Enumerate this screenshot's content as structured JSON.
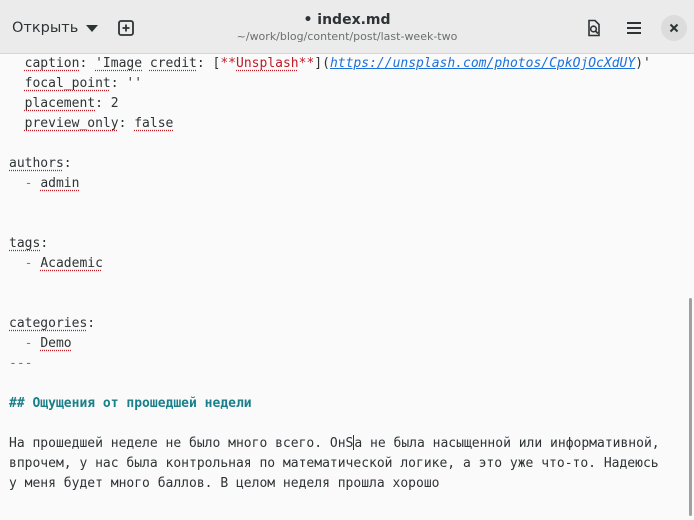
{
  "header": {
    "open_label": "Открыть",
    "title": "• index.md",
    "subtitle": "~/work/blog/content/post/last-week-two"
  },
  "editor": {
    "caption_key": "caption",
    "caption_quote": "'Image",
    "caption_credit": "credit",
    "caption_bold_open": "**",
    "caption_unsplash": "Unsplash",
    "caption_bold_close": "**",
    "caption_url": "https://unsplash.com/photos/CpkOjOcXdUY",
    "focal_point_key": "focal_point",
    "focal_point_value": "''",
    "placement_key": "placement",
    "placement_value": "2",
    "preview_only_key": "preview_only",
    "preview_only_value": "false",
    "authors_key": "authors",
    "authors_item": "admin",
    "tags_key": "tags",
    "tags_item": "Academic",
    "categories_key": "categories",
    "categories_item": "Demo",
    "front_matter_end": "---",
    "heading": "## Ощущения от прошедшей недели",
    "para_line1_a": "На прошедшей неделе не было много всего. ОнS",
    "para_line1_b": "а не была насыщенной или информативной,",
    "para_line2": "впрочем, у нас была контрольная по математической логике, а это уже что-то. Надеюсь",
    "para_line3": "у меня будет много баллов. В целом неделя прошла хорошо"
  }
}
